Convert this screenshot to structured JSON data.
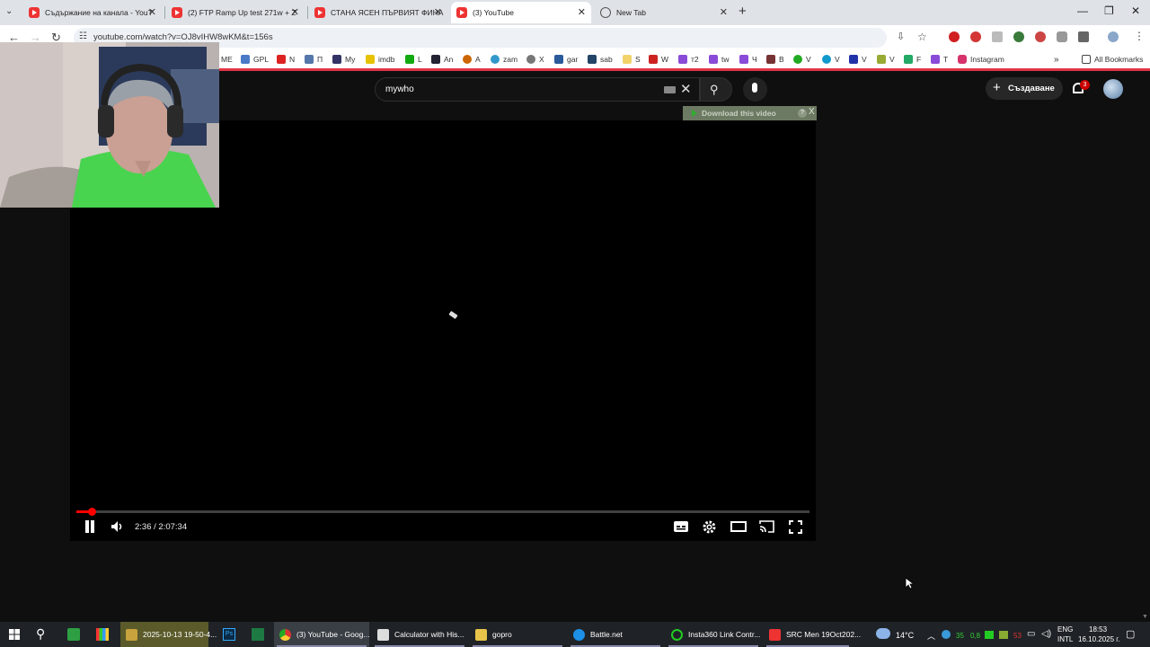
{
  "browser": {
    "tabs": [
      {
        "title": "Съдържание на канала - YouT",
        "active": false
      },
      {
        "title": "(2) FTP Ramp Up test 271w + Z",
        "active": false
      },
      {
        "title": "СТАНА ЯСЕН ПЪРВИЯТ ФИНА",
        "active": false
      },
      {
        "title": "(3) YouTube",
        "active": true
      },
      {
        "title": "New Tab",
        "active": false
      }
    ],
    "url": "youtube.com/watch?v=OJ8vIHW8wKM&t=156s",
    "bookmarks": [
      "ME",
      "GPL",
      "N",
      "П",
      "My",
      "imdb",
      "L",
      "An",
      "A",
      "zam",
      "X",
      "gar",
      "sab",
      "S",
      "W",
      "т2",
      "tw",
      "Ч",
      "B",
      "V",
      "V",
      "V",
      "V",
      "F",
      "T",
      "Instagram"
    ],
    "all_bookmarks": "All Bookmarks",
    "accent": "#e23546"
  },
  "youtube": {
    "search_query": "mywho",
    "create_label": "Създаване",
    "notifications_count": "3",
    "download_bar": "Download this video",
    "help_glyph": "?",
    "close_glyph": "X",
    "player": {
      "current_time": "2:36",
      "duration": "2:07:34",
      "time_display": "2:36 / 2:07:34",
      "progress_fraction": 0.0204
    }
  },
  "taskbar": {
    "apps": [
      {
        "label": "2025-10-13 19-50-4...",
        "icon": "folder-icon",
        "color": "#c8a23c",
        "active": true
      },
      {
        "label": "(3) YouTube - Goog...",
        "icon": "chrome-icon",
        "color": "#d9b13b",
        "active": true
      },
      {
        "label": "Calculator with His...",
        "icon": "calculator-icon",
        "color": "#ddd",
        "active": false
      },
      {
        "label": "gopro",
        "icon": "folder-icon",
        "color": "#e8c34a",
        "active": false
      },
      {
        "label": "Battle.net",
        "icon": "battlenet-icon",
        "color": "#1c8fe6",
        "active": false
      },
      {
        "label": "Insta360 Link Contr...",
        "icon": "insta360-icon",
        "color": "#2c2",
        "active": false
      },
      {
        "label": "SRC Men 19Oct202...",
        "icon": "pdf-icon",
        "color": "#e33",
        "active": false
      }
    ],
    "weather": "14°C",
    "tray_num1": "35",
    "tray_num2": "0,8",
    "tray_num3": "53",
    "lang1": "ENG",
    "lang2": "INTL",
    "time": "18:53",
    "date": "16.10.2025 г."
  }
}
